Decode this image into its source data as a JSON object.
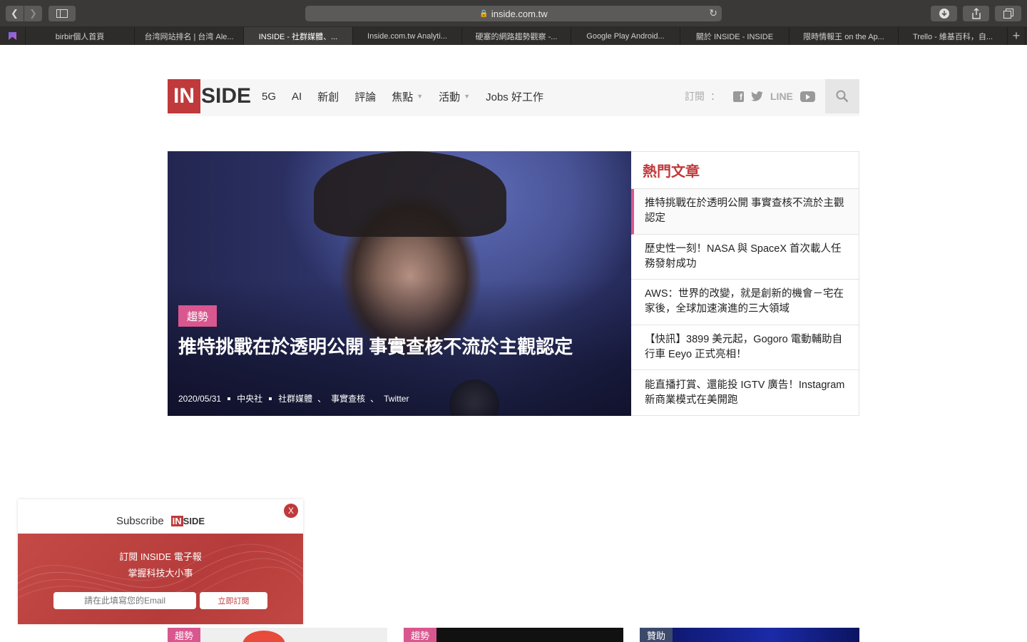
{
  "browser": {
    "url": "inside.com.tw",
    "tabs": [
      {
        "label": "birbir個人首頁"
      },
      {
        "label": "台湾网站排名 | 台湾 Ale..."
      },
      {
        "label": "INSIDE - 社群媒體、..."
      },
      {
        "label": "Inside.com.tw Analyti..."
      },
      {
        "label": "硬塞的網路趨勢觀察 -..."
      },
      {
        "label": "Google Play Android..."
      },
      {
        "label": "關於 INSIDE - INSIDE"
      },
      {
        "label": "限時情報王 on the Ap..."
      },
      {
        "label": "Trello - 維基百科，自..."
      }
    ],
    "active_tab_index": 2
  },
  "site": {
    "logo_in": "IN",
    "logo_side": "SIDE",
    "nav": [
      {
        "label": "5G"
      },
      {
        "label": "AI"
      },
      {
        "label": "新創"
      },
      {
        "label": "評論"
      },
      {
        "label": "焦點",
        "has_dropdown": true
      },
      {
        "label": "活動",
        "has_dropdown": true
      },
      {
        "label": "Jobs 好工作"
      }
    ],
    "subscribe_label": "訂閱",
    "subscribe_colon": "：",
    "line_label": "LINE",
    "accent": "#c0393b",
    "pink": "#d9578f"
  },
  "hero": {
    "tag": "趨勢",
    "title": "推特挑戰在於透明公開 事實查核不流於主觀認定",
    "date": "2020/05/31",
    "source": "中央社",
    "tags": [
      "社群媒體",
      "事實查核",
      "Twitter"
    ],
    "tag_sep": "、"
  },
  "popular": {
    "heading": "熱門文章",
    "items": [
      "推特挑戰在於透明公開 事實查核不流於主觀認定",
      "歷史性一刻！NASA 與 SpaceX 首次載人任務發射成功",
      "AWS：世界的改變，就是創新的機會－宅在家後，全球加速演進的三大領域",
      "【快訊】3899 美元起，Gogoro 電動輔助自行車 Eeyo 正式亮相！",
      "能直播打賞、還能投 IGTV 廣告！Instagram 新商業模式在美開跑"
    ]
  },
  "cards": [
    {
      "tag": "趨勢"
    },
    {
      "tag": "趨勢"
    },
    {
      "tag": "贊助"
    }
  ],
  "subscribe_popup": {
    "title": "Subscribe",
    "logo_in": "IN",
    "logo_side": "SIDE",
    "close": "X",
    "line1": "訂閱 INSIDE 電子報",
    "line2": "掌握科技大小事",
    "email_placeholder": "請在此填寫您的Email",
    "button": "立即訂閱"
  }
}
